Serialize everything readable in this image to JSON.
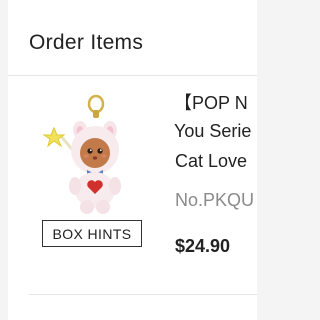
{
  "order": {
    "section_title": "Order Items"
  },
  "item": {
    "name_line1": "【POP N",
    "name_line2": "You Serie",
    "subname": "Cat Love",
    "sku": "No.PKQU",
    "price": "$24.90",
    "image_icon": "plush-doll-keychain-icon",
    "box_hints_label": "BOX HINTS"
  },
  "colors": {
    "text_primary": "#222222",
    "text_secondary": "#8a8a8a",
    "divider": "#e6e6e6",
    "background": "#f4f4f4",
    "card": "#ffffff"
  }
}
